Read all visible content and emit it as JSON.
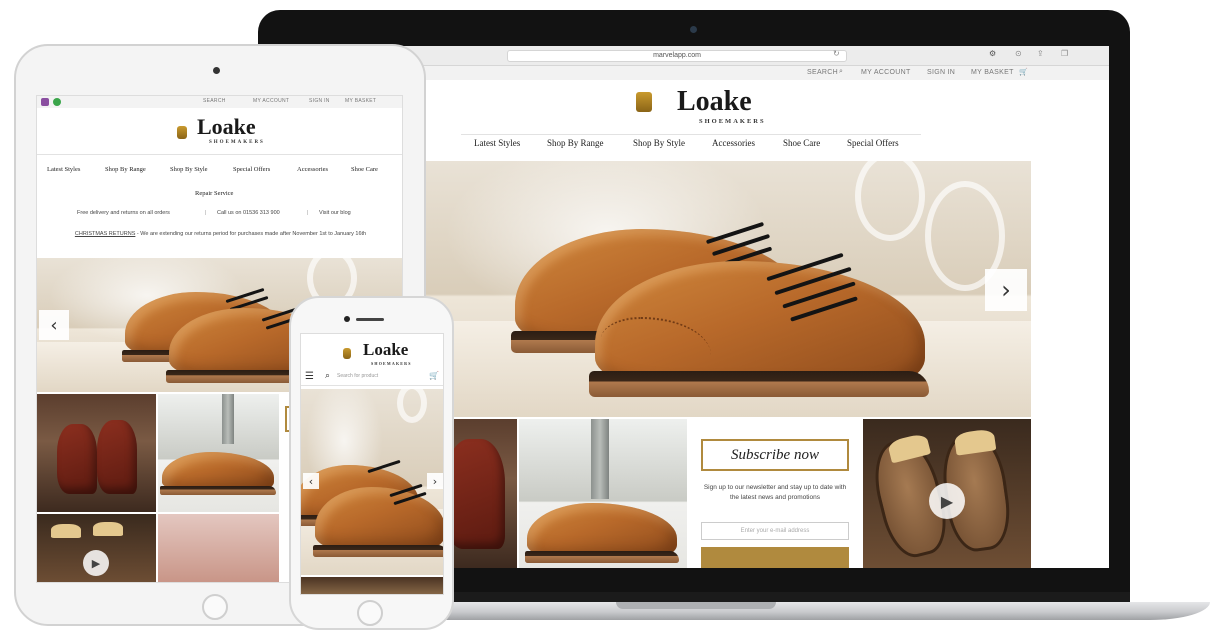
{
  "brand": {
    "name": "Loake",
    "tagline": "SHOEMAKERS",
    "colors": {
      "gold": "#b08a3e",
      "leather": "#b8692a",
      "device_dark": "#121212"
    }
  },
  "laptop": {
    "address": "marvelapp.com",
    "utility_links": [
      "SEARCH",
      "MY ACCOUNT",
      "SIGN IN",
      "MY BASKET"
    ],
    "nav": [
      "Latest Styles",
      "Shop By Range",
      "Shop By Style",
      "Accessories",
      "Shoe Care",
      "Special Offers"
    ],
    "subscribe": {
      "title": "Subscribe now",
      "text": "Sign up to our newsletter and stay up to date with the latest news and promotions",
      "placeholder": "Enter your e-mail address"
    }
  },
  "tablet": {
    "utility_links": [
      "SEARCH",
      "MY ACCOUNT",
      "SIGN IN",
      "MY BASKET"
    ],
    "nav": [
      "Latest Styles",
      "Shop By Range",
      "Shop By Style",
      "Special Offers",
      "Accessories",
      "Shoe Care"
    ],
    "nav_extra": "Repair Service",
    "info_bar": [
      "Free delivery and returns on all orders",
      "Call us on 01536 313 900",
      "Visit our blog"
    ],
    "notice_label": "CHRISTMAS RETURNS",
    "notice_text": " - We are extending our returns period for purchases made after November 1st to January 16th"
  },
  "phone": {
    "search_placeholder": "Search for product"
  },
  "icons": [
    "search-icon",
    "cart-icon",
    "menu-icon",
    "chevron-left-icon",
    "chevron-right-icon",
    "play-icon"
  ]
}
